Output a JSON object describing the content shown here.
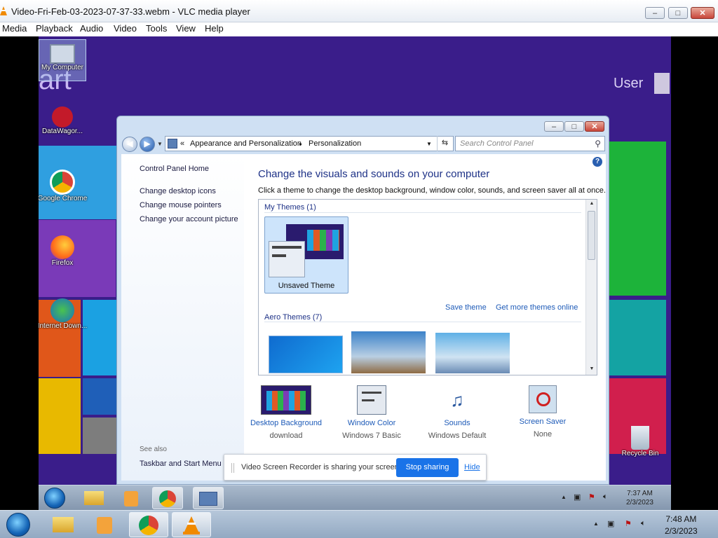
{
  "vlc": {
    "title": "Video-Fri-Feb-03-2023-07-37-33.webm - VLC media player",
    "menu": [
      "Media",
      "Playback",
      "Audio",
      "Video",
      "Tools",
      "View",
      "Help"
    ],
    "min": "–",
    "max": "□",
    "close": "✕"
  },
  "desktop": {
    "start_text": "art",
    "user": "User",
    "icons": [
      {
        "label": "My Computer"
      },
      {
        "label": "DataWagor..."
      },
      {
        "label": "Google Chrome"
      },
      {
        "label": "Firefox"
      },
      {
        "label": "Internet Down..."
      },
      {
        "label": "Recycle Bin"
      }
    ]
  },
  "cp": {
    "min": "–",
    "max": "□",
    "close": "✕",
    "breadcrumb": [
      "«",
      "Appearance and Personalization",
      "▸",
      "Personalization"
    ],
    "search_placeholder": "Search Control Panel",
    "help": "?",
    "left_links": [
      "Control Panel Home",
      "Change desktop icons",
      "Change mouse pointers",
      "Change your account picture"
    ],
    "see_also": "See also",
    "see_also_links": [
      "Taskbar and Start Menu"
    ],
    "heading": "Change the visuals and sounds on your computer",
    "subheading": "Click a theme to change the desktop background, window color, sounds, and screen saver all at once.",
    "my_themes": "My Themes (1)",
    "unsaved_theme": "Unsaved Theme",
    "save_theme": "Save theme",
    "get_more": "Get more themes online",
    "aero_themes": "Aero Themes (7)",
    "bottom": [
      {
        "label": "Desktop Background",
        "value": "download"
      },
      {
        "label": "Window Color",
        "value": "Windows 7 Basic"
      },
      {
        "label": "Sounds",
        "value": "Windows Default"
      },
      {
        "label": "Screen Saver",
        "value": "None"
      }
    ]
  },
  "share": {
    "message": "Video Screen Recorder is sharing your screen.",
    "stop": "Stop sharing",
    "hide": "Hide"
  },
  "inner_taskbar": {
    "time": "7:37 AM",
    "date": "2/3/2023"
  },
  "outer_taskbar": {
    "time": "7:48 AM",
    "date": "2/3/2023"
  }
}
